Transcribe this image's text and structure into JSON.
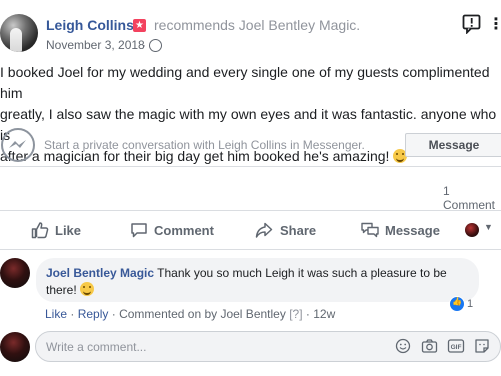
{
  "post": {
    "author": "Leigh Collins",
    "recommendation_text": "recommends Joel Bentley Magic.",
    "date": "November 3, 2018",
    "body_line1": "I booked Joel for my wedding and every single one of my guests complimented him",
    "body_line2": "greatly, I also saw the magic with my own eyes and it was fantastic. anyone who is",
    "body_line3": "after a magician for their big day get him booked he's amazing!"
  },
  "messenger": {
    "prompt": "Start a private conversation with Leigh Collins in Messenger.",
    "button_label": "Message"
  },
  "stats": {
    "comments": "1 Comment"
  },
  "actions": {
    "like": "Like",
    "comment": "Comment",
    "share": "Share",
    "message": "Message"
  },
  "comment": {
    "author": "Joel Bentley Magic",
    "text_line1": "Thank you so much Leigh it was such a pleasure to be",
    "text_line2": "there!",
    "like_count": "1",
    "meta_like": "Like",
    "meta_reply": "Reply",
    "meta_commented": "Commented on by Joel Bentley",
    "meta_help": "[?]",
    "meta_time": "12w"
  },
  "composer": {
    "placeholder": "Write a comment..."
  },
  "icons": [
    "globe-icon",
    "recommend-icon",
    "report-icon",
    "messenger-icon",
    "like-icon",
    "comment-icon",
    "share-icon",
    "message-icon",
    "emoji-icon",
    "camera-icon",
    "gif-icon",
    "sticker-icon"
  ]
}
